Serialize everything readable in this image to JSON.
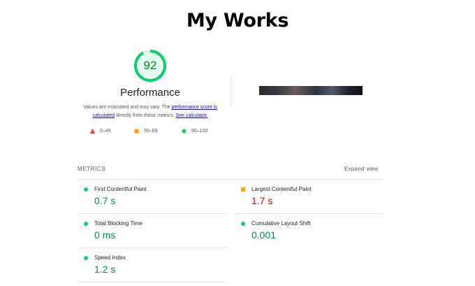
{
  "heading": "My Works",
  "summary": {
    "score": "92",
    "score_fraction": 0.92,
    "category": "Performance",
    "note_prefix": "Values are estimated and may vary. The ",
    "note_link1": "performance score is calculated",
    "note_middle": " directly from these metrics. ",
    "note_link2": "See calculator."
  },
  "legend": [
    {
      "icon": "triangle-icon",
      "color": "#ff3333",
      "label": "0–49"
    },
    {
      "icon": "square-icon",
      "color": "#ffa400",
      "label": "50–89"
    },
    {
      "icon": "circle-icon",
      "color": "#0cce6b",
      "label": "90–100"
    }
  ],
  "metrics_section": {
    "heading": "METRICS",
    "expand": "Expand view",
    "items": [
      {
        "name": "First Contentful Paint",
        "value": "0.7 s",
        "status": "good"
      },
      {
        "name": "Largest Contentful Paint",
        "value": "1.7 s",
        "status": "average"
      },
      {
        "name": "Total Blocking Time",
        "value": "0 ms",
        "status": "good"
      },
      {
        "name": "Cumulative Layout Shift",
        "value": "0.001",
        "status": "good"
      },
      {
        "name": "Speed Index",
        "value": "1.2 s",
        "status": "good"
      }
    ]
  },
  "colors": {
    "good": "#0cce6b",
    "average": "#ffa400",
    "poor": "#ff3333",
    "gauge_text": "#0a7d3a"
  }
}
